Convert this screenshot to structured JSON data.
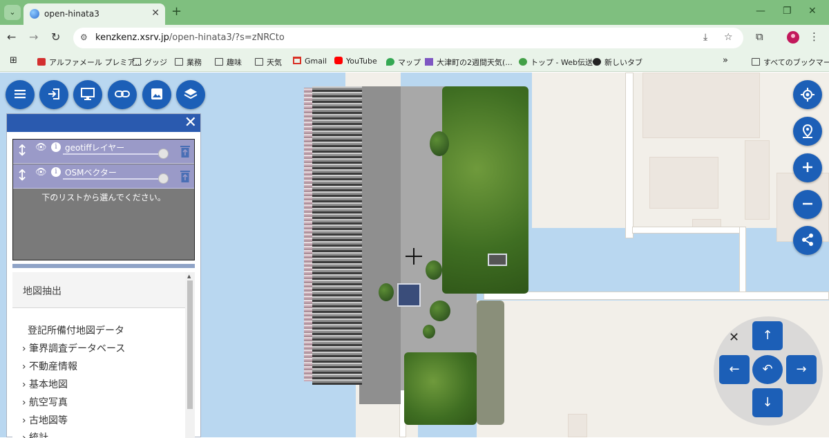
{
  "browser": {
    "tab_title": "open-hinata3",
    "new_tab_symbol": "+",
    "url_host": "kenzkenz.xsrv.jp",
    "url_path": "/open-hinata3/?s=zNRCto"
  },
  "bookmarks": [
    {
      "label": "アルファメール プレミア...",
      "icon": "alphamail-icon"
    },
    {
      "label": "グッジ",
      "icon": "folder-icon"
    },
    {
      "label": "業務",
      "icon": "folder-icon"
    },
    {
      "label": "趣味",
      "icon": "folder-icon"
    },
    {
      "label": "天気",
      "icon": "folder-icon"
    },
    {
      "label": "Gmail",
      "icon": "gmail-icon"
    },
    {
      "label": "YouTube",
      "icon": "youtube-icon"
    },
    {
      "label": "マップ",
      "icon": "maps-icon"
    },
    {
      "label": "大津町の2週間天気(...",
      "icon": "weather-icon"
    },
    {
      "label": "トップ - Web伝送",
      "icon": "webden-icon"
    },
    {
      "label": "新しいタブ",
      "icon": "globe-icon"
    }
  ],
  "all_bookmarks_label": "すべてのブックマーク",
  "layer_panel": {
    "layers": [
      {
        "name": "geotiffレイヤー"
      },
      {
        "name": "OSMベクター"
      }
    ],
    "hint": "下のリストから選んでください。",
    "list_title": "地図抽出",
    "list_items": [
      "登記所備付地図データ",
      "› 筆界調査データベース",
      "› 不動産情報",
      "› 基本地図",
      "› 航空写真",
      "› 古地図等",
      "› 統計"
    ]
  },
  "map": {
    "accent_color": "#1c5fb7",
    "water_color": "#b9d7f0",
    "land_color": "#f2efe9"
  }
}
